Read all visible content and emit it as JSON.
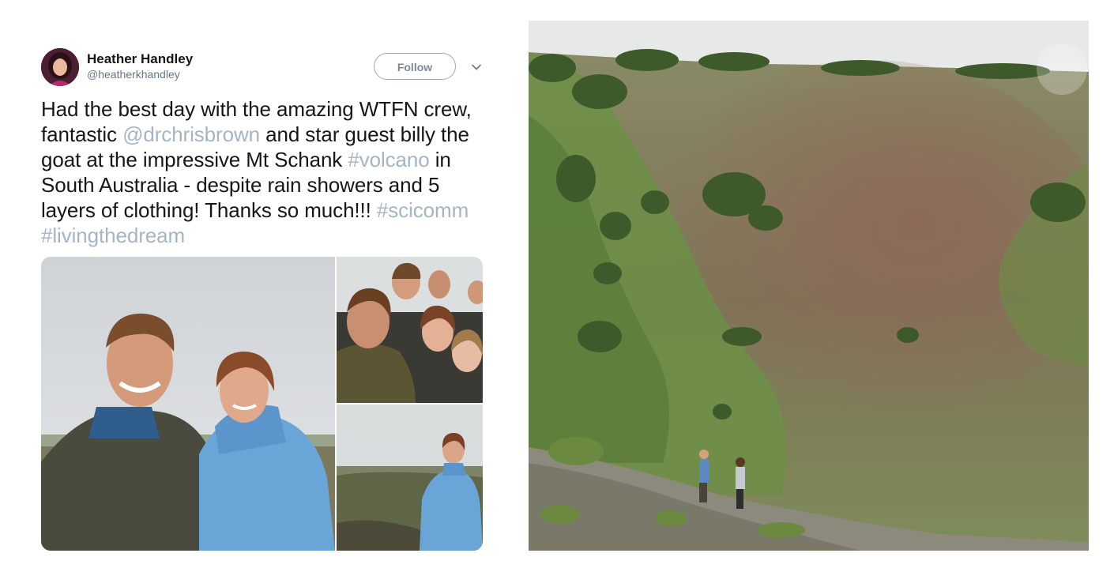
{
  "tweet": {
    "author": {
      "display_name": "Heather Handley",
      "handle": "@heatherkhandley",
      "avatar_icon": "profile-photo"
    },
    "follow_label": "Follow",
    "menu_icon": "chevron-down-icon",
    "text_parts": [
      "Had the best day with the amazing WTFN crew, fantastic ",
      "@drchrisbrown",
      " and star guest billy the goat at the impressive Mt Schank ",
      "#volcano",
      " in South Australia - despite rain showers and 5 layers of clothing! Thanks so much!!! ",
      "#scicomm",
      " ",
      "#livingthedream"
    ],
    "colors": {
      "text": "#14171a",
      "link": "#a5b5c4",
      "handle": "#657786"
    }
  },
  "media": {
    "photos": [
      "selfie-two-people-photo",
      "group-selfie-photo",
      "woman-on-crater-rim-photo"
    ]
  },
  "landscape": {
    "photo": "volcano-crater-landscape-photo"
  }
}
